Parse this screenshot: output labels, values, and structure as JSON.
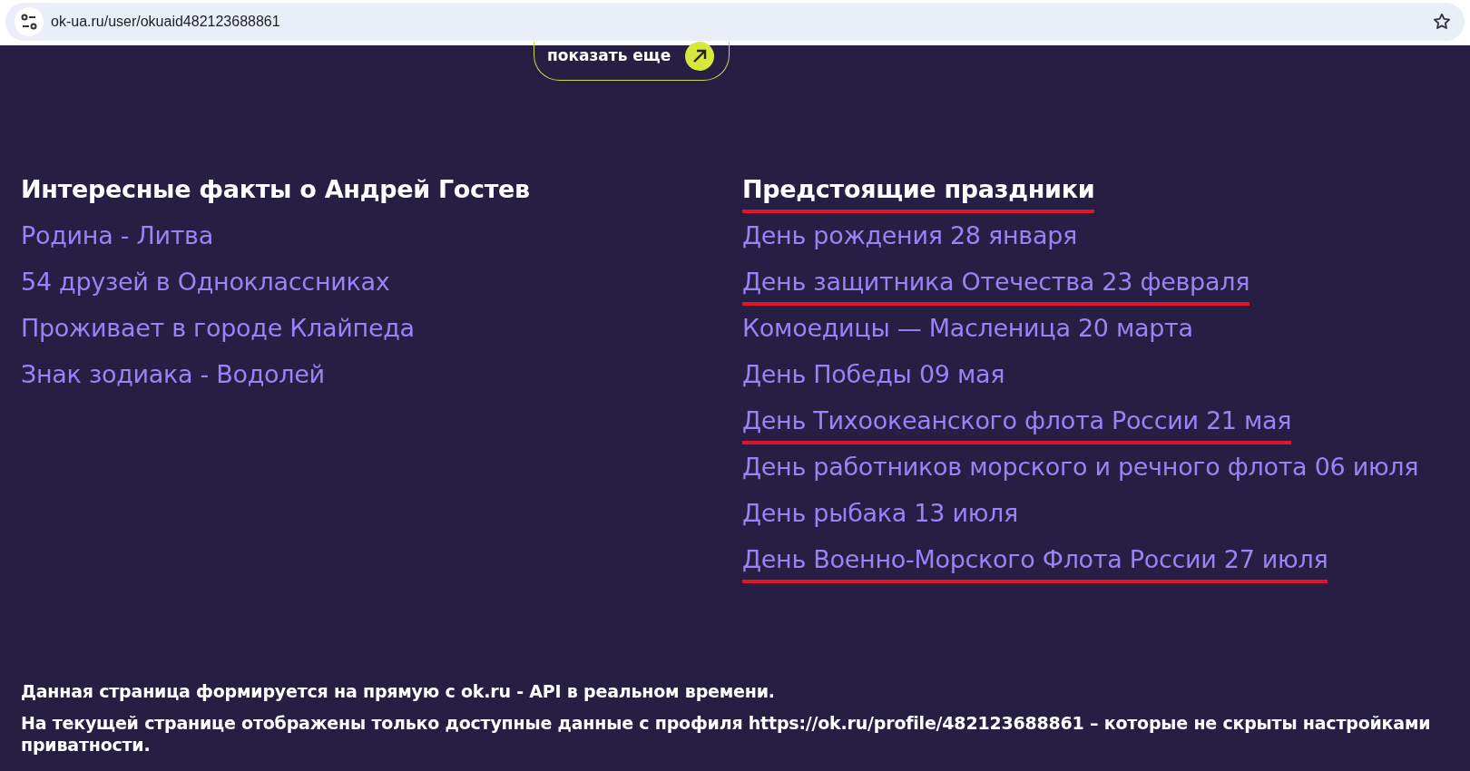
{
  "browser": {
    "url": "ok-ua.ru/user/okuaid482123688861"
  },
  "show_more": {
    "label": "показать еще"
  },
  "facts": {
    "title": "Интересные факты о Андрей Гостев",
    "items": [
      {
        "text": "Родина - Литва"
      },
      {
        "text": "54 друзей в Одноклассниках"
      },
      {
        "text": "Проживает в городе Клайпеда"
      },
      {
        "text": "Знак зодиака - Водолей"
      }
    ]
  },
  "holidays": {
    "title": "Предстоящие праздники",
    "highlighted": true,
    "items": [
      {
        "text": "День рождения 28 января",
        "highlighted": false
      },
      {
        "text": "День защитника Отечества 23 февраля",
        "highlighted": true
      },
      {
        "text": "Комоедицы — Масленица 20 марта",
        "highlighted": false
      },
      {
        "text": "День Победы 09 мая",
        "highlighted": false
      },
      {
        "text": "День Тихоокеанского флота России 21 мая",
        "highlighted": true
      },
      {
        "text": "День работников морского и речного флота 06 июля",
        "highlighted": false
      },
      {
        "text": "День рыбака 13 июля",
        "highlighted": false
      },
      {
        "text": "День Военно-Морского Флота России 27 июля",
        "highlighted": true
      }
    ]
  },
  "footer": [
    "Данная страница формируется на прямую с ok.ru - API в реальном времени.",
    "На текущей странице отображены только доступные данные с профиля https://ok.ru/profile/482123688861 – которые не скрыты настройками приватности."
  ]
}
